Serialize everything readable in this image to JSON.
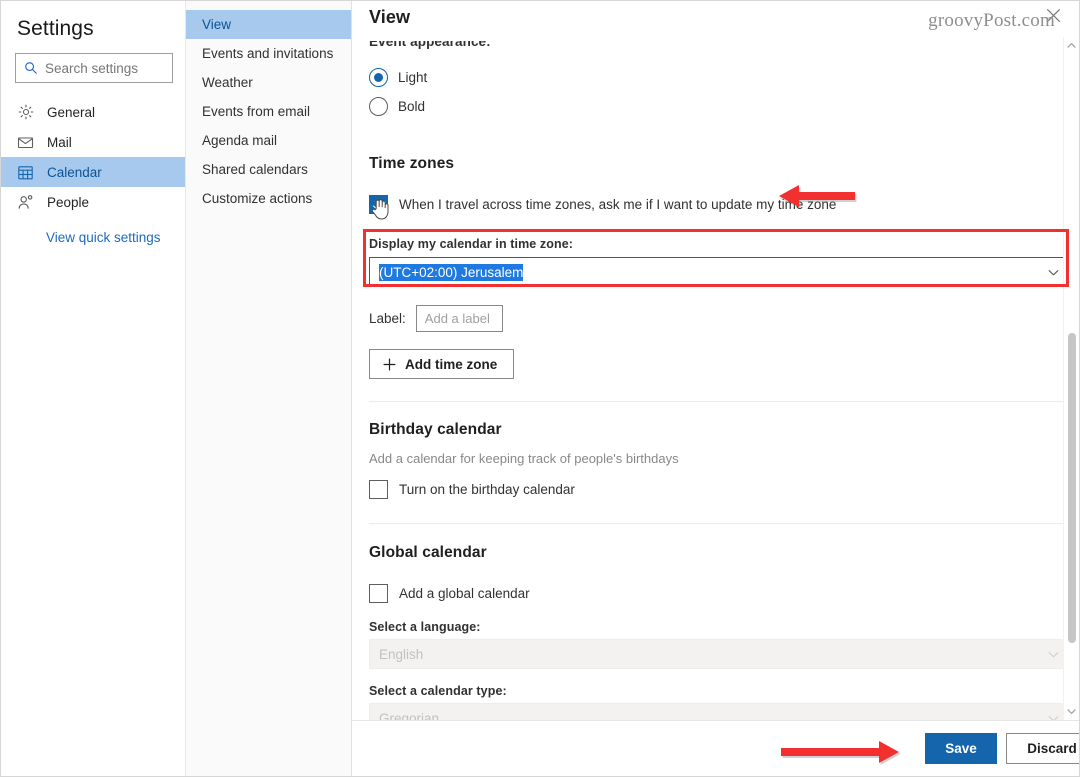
{
  "sidebar": {
    "title": "Settings",
    "search": {
      "placeholder": "Search settings",
      "icon": "search-icon"
    },
    "items": [
      {
        "label": "General",
        "icon": "gear-icon",
        "selected": false
      },
      {
        "label": "Mail",
        "icon": "envelope-icon",
        "selected": false
      },
      {
        "label": "Calendar",
        "icon": "calendar-icon",
        "selected": true
      },
      {
        "label": "People",
        "icon": "person-icon",
        "selected": false
      }
    ],
    "quick_settings_link": "View quick settings"
  },
  "subnav": {
    "items": [
      {
        "label": "View",
        "selected": true
      },
      {
        "label": "Events and invitations",
        "selected": false
      },
      {
        "label": "Weather",
        "selected": false
      },
      {
        "label": "Events from email",
        "selected": false
      },
      {
        "label": "Agenda mail",
        "selected": false
      },
      {
        "label": "Shared calendars",
        "selected": false
      },
      {
        "label": "Customize actions",
        "selected": false
      }
    ]
  },
  "main": {
    "header_title": "View",
    "event_appearance": {
      "label": "Event appearance:",
      "options": [
        {
          "label": "Light",
          "checked": true
        },
        {
          "label": "Bold",
          "checked": false
        }
      ]
    },
    "time_zones": {
      "heading": "Time zones",
      "travel_checkbox": {
        "label": "When I travel across time zones, ask me if I want to update my time zone",
        "checked": true
      },
      "display_label": "Display my calendar in time zone:",
      "display_value": "(UTC+02:00) Jerusalem",
      "label_field_label": "Label:",
      "label_field_placeholder": "Add a label",
      "add_button": "Add time zone"
    },
    "birthday_calendar": {
      "heading": "Birthday calendar",
      "description": "Add a calendar for keeping track of people's birthdays",
      "checkbox_label": "Turn on the birthday calendar",
      "checked": false
    },
    "global_calendar": {
      "heading": "Global calendar",
      "checkbox_label": "Add a global calendar",
      "checked": false,
      "language_label": "Select a language:",
      "language_value": "English",
      "calendar_type_label": "Select a calendar type:",
      "calendar_type_value": "Gregorian"
    }
  },
  "footer": {
    "save_label": "Save",
    "discard_label": "Discard"
  },
  "overlay": {
    "watermark": "groovyPost.com",
    "close_icon": "close-icon",
    "accent_red": "#f2302f",
    "accent_blue": "#1565ad",
    "highlight_blue": "#a6c9ed"
  }
}
